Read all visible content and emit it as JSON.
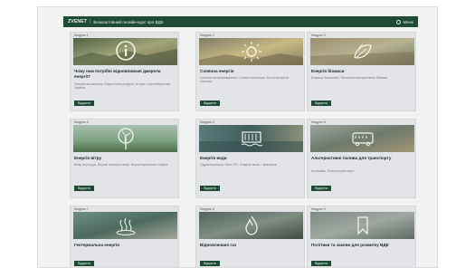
{
  "header": {
    "brand": "ZVENET",
    "subtitle": "Безкоштовний онлайн-курс про ВДЕ",
    "menu_label": "Меню"
  },
  "cards": [
    {
      "module": "Модуль 1",
      "title": "Чому нам потрібні відновлювані джерела енергії?",
      "description": "Основні визначення. Енергетичні ресурси. Історія і стан енергетики України.",
      "button": "Відкрити",
      "icon": "info-icon",
      "accent": "#8a9a6a"
    },
    {
      "module": "Модуль 2",
      "title": "Сонячна енергія",
      "description": "Сонячне випромінювання. Сонячні колектори. Фотоелектричні системи.",
      "button": "Відкрити",
      "icon": "sun-icon",
      "accent": "#c3a86c"
    },
    {
      "module": "Модуль 3",
      "title": "Енергія біомаси",
      "description": "Біомаса. Біопаливо. Технології використання біомаси.",
      "button": "Відкрити",
      "icon": "leaf-icon",
      "accent": "#9aa17a"
    },
    {
      "module": "Модуль 4",
      "title": "Енергія вітру",
      "description": "Вітер як ресурс. Вітрові електростанції. Вітроенергетика в Україні.",
      "button": "Відкрити",
      "icon": "wind-turbine-icon",
      "accent": "#7ea08c"
    },
    {
      "module": "Модуль 5",
      "title": "Енергія води",
      "description": "Гідроенергетика. Малі ГЕС. Енергія хвиль і припливів.",
      "button": "Відкрити",
      "icon": "dam-icon",
      "accent": "#6f8f8a"
    },
    {
      "module": "Модуль 6",
      "title": "Альтернативні палива для транспорту",
      "description": "Біопаливо. Електротранспорт.",
      "button": "Відкрити",
      "icon": "bus-icon",
      "accent": "#8d8a78"
    },
    {
      "module": "Модуль 7",
      "title": "Геотермальна енергія",
      "description": "",
      "button": "Відкрити",
      "icon": "geothermal-icon",
      "accent": "#7b9486"
    },
    {
      "module": "Модуль 8",
      "title": "Відновлювані газ",
      "description": "",
      "button": "Відкрити",
      "icon": "flame-icon",
      "accent": "#7c8a7e"
    },
    {
      "module": "Модуль 9",
      "title": "Політики та закони для розвитку ВДЕ",
      "description": "",
      "button": "Відкрити",
      "icon": "bookmark-icon",
      "accent": "#8b9690"
    }
  ]
}
